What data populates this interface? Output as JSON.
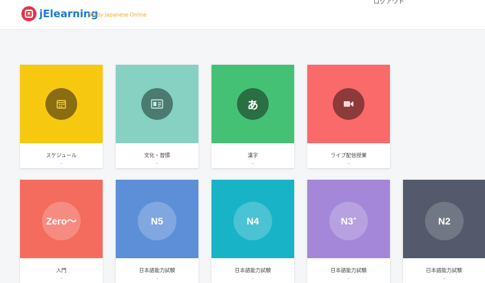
{
  "header": {
    "brand": "jElearning",
    "tagline": "Study Japanese Online",
    "corner_text": "ログアウト"
  },
  "cards_row1": [
    {
      "label": "スケジュール",
      "icon": "calendar-icon",
      "color": "#f6c80f",
      "circle": "#8a6c12"
    },
    {
      "label": "文化・習慣",
      "icon": "id-card-icon",
      "color": "#86d1c2",
      "circle": "#4a7a70"
    },
    {
      "label": "漢字",
      "icon": "hiragana-a-icon",
      "glyph": "あ",
      "color": "#45c175",
      "circle": "#2a6e43"
    },
    {
      "label": "ライブ配信授業",
      "icon": "video-camera-icon",
      "color": "#fb6a6a",
      "circle": "#8c3a3a"
    }
  ],
  "cards_row2": [
    {
      "text": "Zero〜",
      "label": "入門",
      "color": "#f46c5e"
    },
    {
      "text": "N5",
      "label": "日本語能力試験",
      "color": "#5d8fd8"
    },
    {
      "text": "N4",
      "label": "日本語能力試験",
      "color": "#19b3c8"
    },
    {
      "text": "N3",
      "sup": "+",
      "label": "日本語能力試験",
      "color": "#a487d8"
    },
    {
      "text": "N2",
      "label": "日本語能力試験",
      "color": "#545a6b"
    }
  ]
}
